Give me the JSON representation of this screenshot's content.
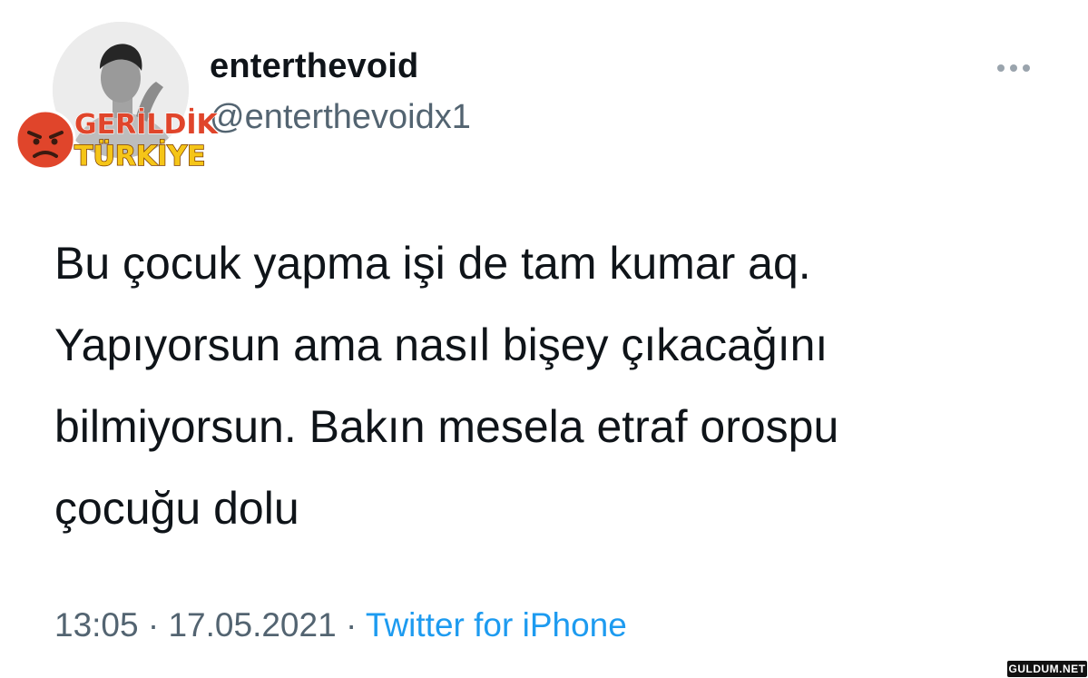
{
  "tweet": {
    "display_name": "enterthevoid",
    "handle": "@enterthevoidx1",
    "body_lines": [
      "Bu çocuk yapma işi de tam kumar aq.",
      "Yapıyorsun ama nasıl bişey çıkacağını",
      "bilmiyorsun. Bakın mesela etraf orospu",
      "çocuğu dolu"
    ],
    "time": "13:05",
    "separator": "·",
    "date": "17.05.2021",
    "source": "Twitter for iPhone"
  },
  "badge": {
    "line1": "GERİLDİK",
    "line2": "TÜRKİYE"
  },
  "watermark": {
    "text": "GULDUM.NET"
  },
  "colors": {
    "text_primary": "#0f1419",
    "text_secondary": "#536471",
    "link": "#1d9bf0",
    "badge_yellow": "#f5c518",
    "badge_red": "#e0452b"
  },
  "icons": {
    "more": "more-horizontal-icon",
    "angry_face": "angry-face-icon"
  }
}
